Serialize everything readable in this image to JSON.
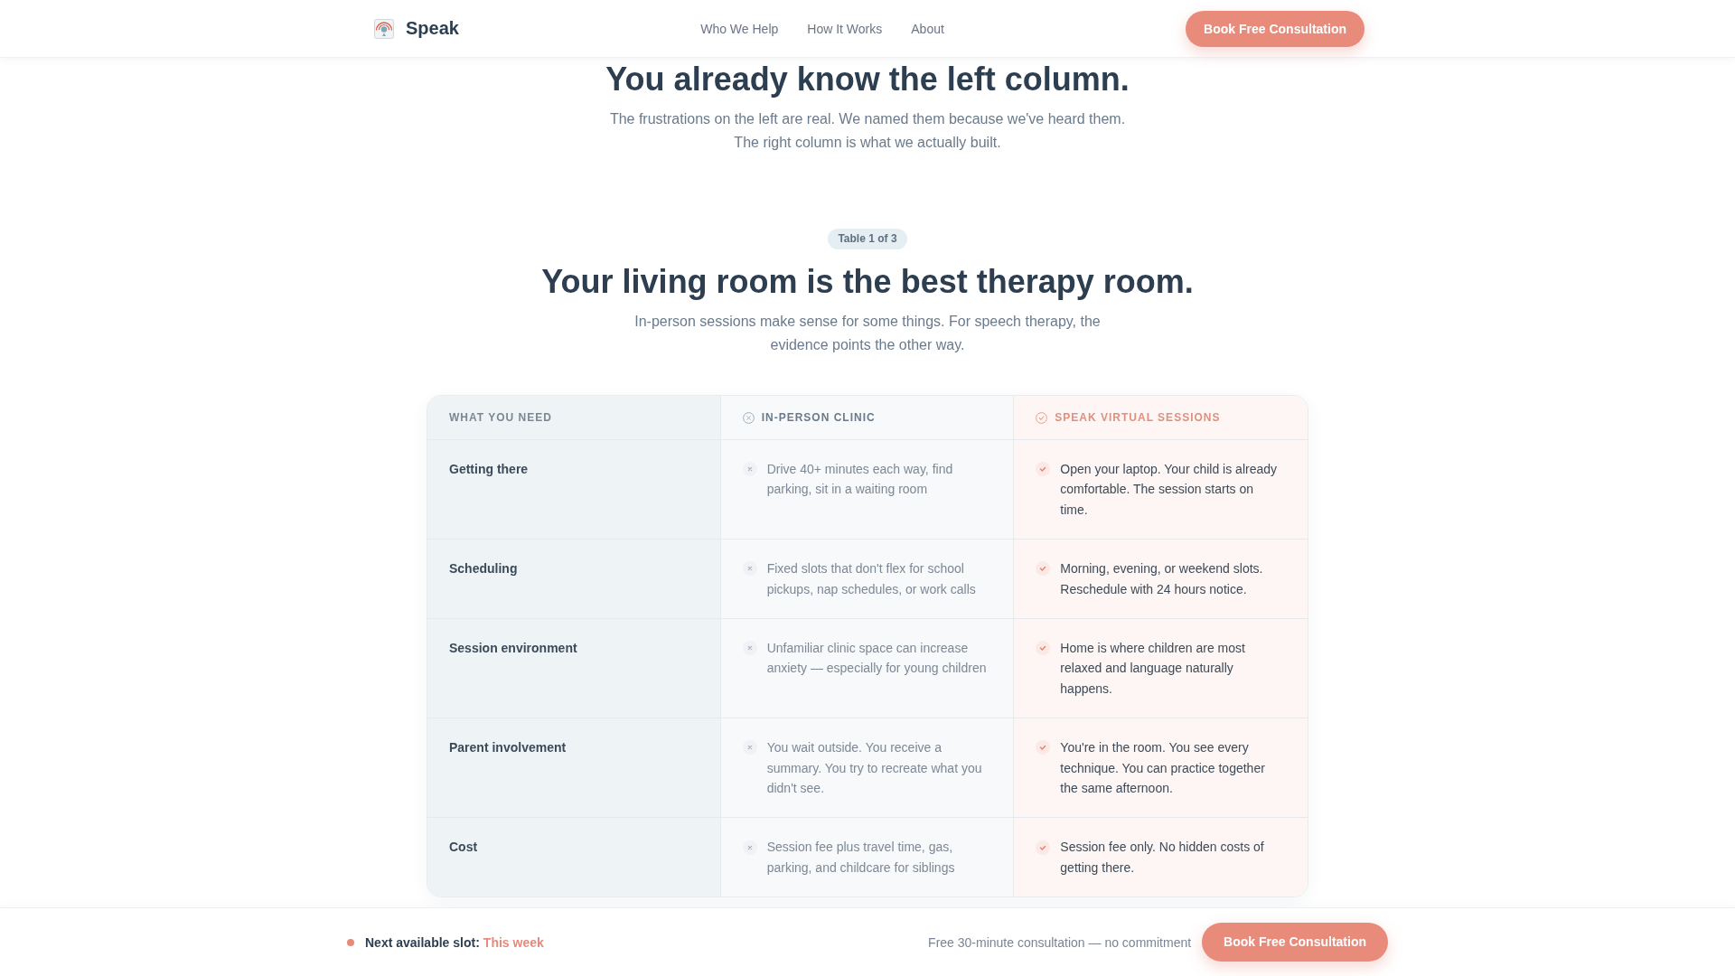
{
  "header": {
    "brand": "Speak",
    "nav": [
      {
        "label": "Who We Help"
      },
      {
        "label": "How It Works"
      },
      {
        "label": "About"
      }
    ],
    "cta": "Book Free Consultation"
  },
  "intro": {
    "title": "You already know the left column.",
    "lines": [
      "The frustrations on the left are real. We named them because we've heard them.",
      "The right column is what we actually built."
    ]
  },
  "section": {
    "badge": "Table 1 of 3",
    "title": "Your living room is the best therapy room.",
    "subtitle": "In-person sessions make sense for some things. For speech therapy, the evidence points the other way."
  },
  "table": {
    "columns": [
      {
        "label": "WHAT YOU NEED",
        "kind": "need"
      },
      {
        "label": "IN-PERSON CLINIC",
        "kind": "con"
      },
      {
        "label": "SPEAK VIRTUAL SESSIONS",
        "kind": "pro"
      }
    ],
    "rows": [
      {
        "cells": [
          "Getting there",
          "Drive 40+ minutes each way, find parking, sit in a waiting room",
          "Open your laptop. Your child is already comfortable. The session starts on time."
        ]
      },
      {
        "cells": [
          "Scheduling",
          "Fixed slots that don't flex for school pickups, nap schedules, or work calls",
          "Morning, evening, or weekend slots. Reschedule with 24 hours notice."
        ]
      },
      {
        "cells": [
          "Session environment",
          "Unfamiliar clinic space can increase anxiety — especially for young children",
          "Home is where children are most relaxed and language naturally happens."
        ]
      },
      {
        "cells": [
          "Parent involvement",
          "You wait outside. You receive a summary. You try to recreate what you didn't see.",
          "You're in the room. You see every technique. You can practice together the same afternoon."
        ]
      },
      {
        "cells": [
          "Cost",
          "Session fee plus travel time, gas, parking, and childcare for siblings",
          "Session fee only. No hidden costs of getting there."
        ]
      }
    ]
  },
  "bottom_bar": {
    "slot_label": "Next available slot:",
    "slot_value": "This week",
    "note": "Free 30-minute consultation — no commitment",
    "cta": "Book Free Consultation"
  }
}
